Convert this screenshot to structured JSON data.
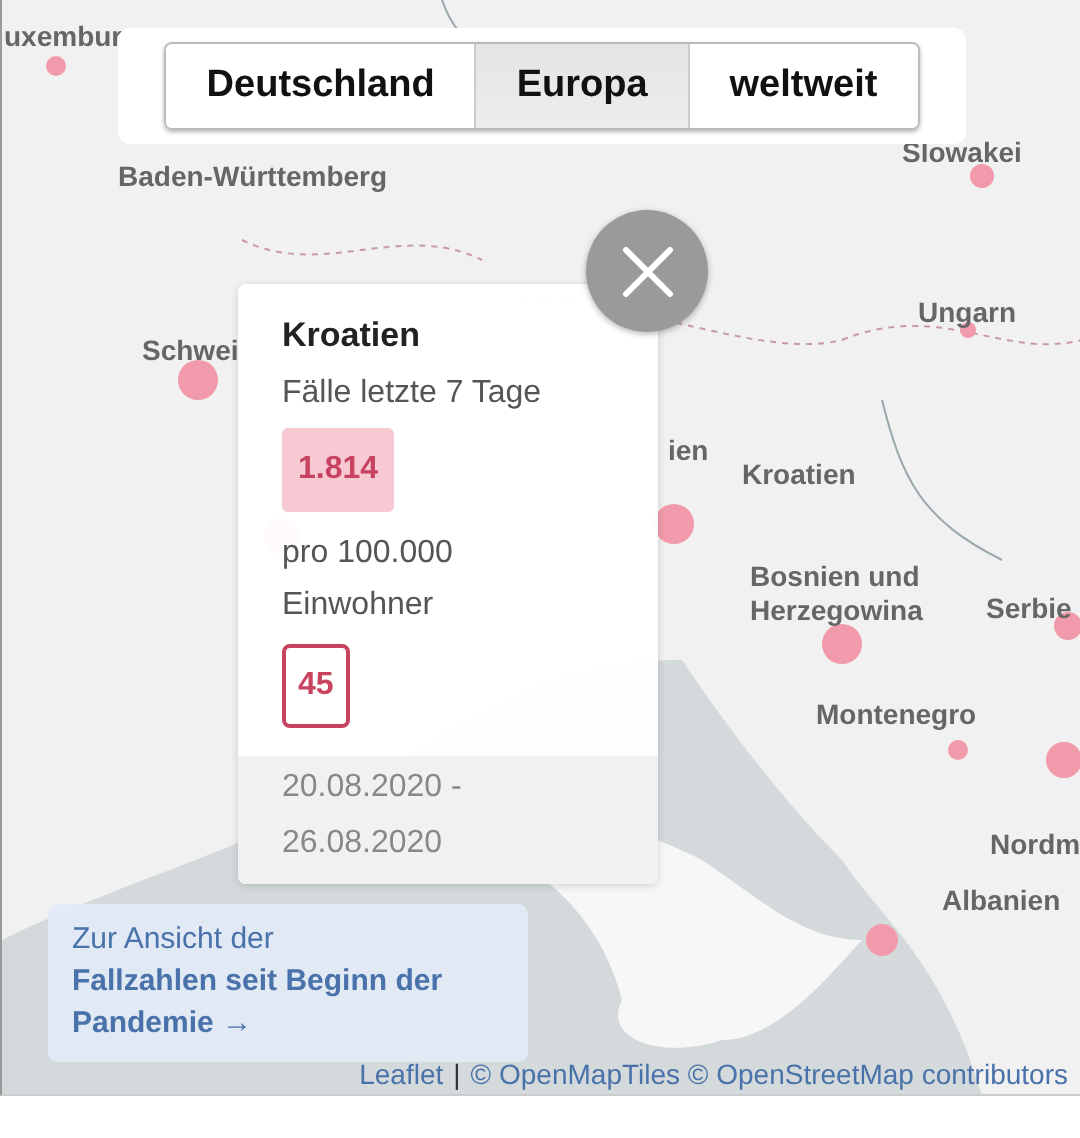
{
  "tabs": [
    {
      "label": "Deutschland",
      "selected": false
    },
    {
      "label": "Europa",
      "selected": true
    },
    {
      "label": "weltweit",
      "selected": false
    }
  ],
  "map_labels": [
    "uxembur",
    "Baden-Württemberg",
    "Slowakei",
    "Schwei",
    "Ungarn",
    "ien",
    "Kroatien",
    "Bosnien und Herzegowina",
    "Serbie",
    "Montenegro",
    "Nordm",
    "Albanien"
  ],
  "popup": {
    "title": "Kroatien",
    "cases_label": "Fälle letzte 7 Tage",
    "cases": "1.814",
    "incidence_label": "pro 100.000 Einwohner",
    "incidence": "45",
    "date_range": "20.08.2020 - 26.08.2020"
  },
  "link_box": {
    "intro": "Zur Ansicht der",
    "link": "Fallzahlen seit Beginn der Pandemie",
    "arrow": "→"
  },
  "attribution": {
    "leaflet": "Leaflet",
    "separator": "|",
    "sources": "© OpenMapTiles © OpenStreetMap contributors"
  }
}
